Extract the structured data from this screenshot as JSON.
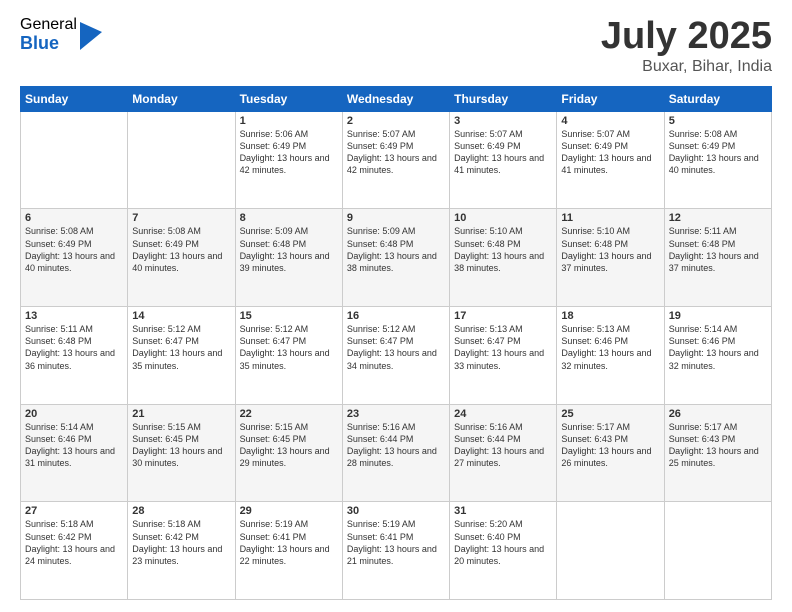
{
  "logo": {
    "general": "General",
    "blue": "Blue"
  },
  "header": {
    "month": "July 2025",
    "location": "Buxar, Bihar, India"
  },
  "weekdays": [
    "Sunday",
    "Monday",
    "Tuesday",
    "Wednesday",
    "Thursday",
    "Friday",
    "Saturday"
  ],
  "weeks": [
    [
      {
        "day": "",
        "sunrise": "",
        "sunset": "",
        "daylight": ""
      },
      {
        "day": "",
        "sunrise": "",
        "sunset": "",
        "daylight": ""
      },
      {
        "day": "1",
        "sunrise": "Sunrise: 5:06 AM",
        "sunset": "Sunset: 6:49 PM",
        "daylight": "Daylight: 13 hours and 42 minutes."
      },
      {
        "day": "2",
        "sunrise": "Sunrise: 5:07 AM",
        "sunset": "Sunset: 6:49 PM",
        "daylight": "Daylight: 13 hours and 42 minutes."
      },
      {
        "day": "3",
        "sunrise": "Sunrise: 5:07 AM",
        "sunset": "Sunset: 6:49 PM",
        "daylight": "Daylight: 13 hours and 41 minutes."
      },
      {
        "day": "4",
        "sunrise": "Sunrise: 5:07 AM",
        "sunset": "Sunset: 6:49 PM",
        "daylight": "Daylight: 13 hours and 41 minutes."
      },
      {
        "day": "5",
        "sunrise": "Sunrise: 5:08 AM",
        "sunset": "Sunset: 6:49 PM",
        "daylight": "Daylight: 13 hours and 40 minutes."
      }
    ],
    [
      {
        "day": "6",
        "sunrise": "Sunrise: 5:08 AM",
        "sunset": "Sunset: 6:49 PM",
        "daylight": "Daylight: 13 hours and 40 minutes."
      },
      {
        "day": "7",
        "sunrise": "Sunrise: 5:08 AM",
        "sunset": "Sunset: 6:49 PM",
        "daylight": "Daylight: 13 hours and 40 minutes."
      },
      {
        "day": "8",
        "sunrise": "Sunrise: 5:09 AM",
        "sunset": "Sunset: 6:48 PM",
        "daylight": "Daylight: 13 hours and 39 minutes."
      },
      {
        "day": "9",
        "sunrise": "Sunrise: 5:09 AM",
        "sunset": "Sunset: 6:48 PM",
        "daylight": "Daylight: 13 hours and 38 minutes."
      },
      {
        "day": "10",
        "sunrise": "Sunrise: 5:10 AM",
        "sunset": "Sunset: 6:48 PM",
        "daylight": "Daylight: 13 hours and 38 minutes."
      },
      {
        "day": "11",
        "sunrise": "Sunrise: 5:10 AM",
        "sunset": "Sunset: 6:48 PM",
        "daylight": "Daylight: 13 hours and 37 minutes."
      },
      {
        "day": "12",
        "sunrise": "Sunrise: 5:11 AM",
        "sunset": "Sunset: 6:48 PM",
        "daylight": "Daylight: 13 hours and 37 minutes."
      }
    ],
    [
      {
        "day": "13",
        "sunrise": "Sunrise: 5:11 AM",
        "sunset": "Sunset: 6:48 PM",
        "daylight": "Daylight: 13 hours and 36 minutes."
      },
      {
        "day": "14",
        "sunrise": "Sunrise: 5:12 AM",
        "sunset": "Sunset: 6:47 PM",
        "daylight": "Daylight: 13 hours and 35 minutes."
      },
      {
        "day": "15",
        "sunrise": "Sunrise: 5:12 AM",
        "sunset": "Sunset: 6:47 PM",
        "daylight": "Daylight: 13 hours and 35 minutes."
      },
      {
        "day": "16",
        "sunrise": "Sunrise: 5:12 AM",
        "sunset": "Sunset: 6:47 PM",
        "daylight": "Daylight: 13 hours and 34 minutes."
      },
      {
        "day": "17",
        "sunrise": "Sunrise: 5:13 AM",
        "sunset": "Sunset: 6:47 PM",
        "daylight": "Daylight: 13 hours and 33 minutes."
      },
      {
        "day": "18",
        "sunrise": "Sunrise: 5:13 AM",
        "sunset": "Sunset: 6:46 PM",
        "daylight": "Daylight: 13 hours and 32 minutes."
      },
      {
        "day": "19",
        "sunrise": "Sunrise: 5:14 AM",
        "sunset": "Sunset: 6:46 PM",
        "daylight": "Daylight: 13 hours and 32 minutes."
      }
    ],
    [
      {
        "day": "20",
        "sunrise": "Sunrise: 5:14 AM",
        "sunset": "Sunset: 6:46 PM",
        "daylight": "Daylight: 13 hours and 31 minutes."
      },
      {
        "day": "21",
        "sunrise": "Sunrise: 5:15 AM",
        "sunset": "Sunset: 6:45 PM",
        "daylight": "Daylight: 13 hours and 30 minutes."
      },
      {
        "day": "22",
        "sunrise": "Sunrise: 5:15 AM",
        "sunset": "Sunset: 6:45 PM",
        "daylight": "Daylight: 13 hours and 29 minutes."
      },
      {
        "day": "23",
        "sunrise": "Sunrise: 5:16 AM",
        "sunset": "Sunset: 6:44 PM",
        "daylight": "Daylight: 13 hours and 28 minutes."
      },
      {
        "day": "24",
        "sunrise": "Sunrise: 5:16 AM",
        "sunset": "Sunset: 6:44 PM",
        "daylight": "Daylight: 13 hours and 27 minutes."
      },
      {
        "day": "25",
        "sunrise": "Sunrise: 5:17 AM",
        "sunset": "Sunset: 6:43 PM",
        "daylight": "Daylight: 13 hours and 26 minutes."
      },
      {
        "day": "26",
        "sunrise": "Sunrise: 5:17 AM",
        "sunset": "Sunset: 6:43 PM",
        "daylight": "Daylight: 13 hours and 25 minutes."
      }
    ],
    [
      {
        "day": "27",
        "sunrise": "Sunrise: 5:18 AM",
        "sunset": "Sunset: 6:42 PM",
        "daylight": "Daylight: 13 hours and 24 minutes."
      },
      {
        "day": "28",
        "sunrise": "Sunrise: 5:18 AM",
        "sunset": "Sunset: 6:42 PM",
        "daylight": "Daylight: 13 hours and 23 minutes."
      },
      {
        "day": "29",
        "sunrise": "Sunrise: 5:19 AM",
        "sunset": "Sunset: 6:41 PM",
        "daylight": "Daylight: 13 hours and 22 minutes."
      },
      {
        "day": "30",
        "sunrise": "Sunrise: 5:19 AM",
        "sunset": "Sunset: 6:41 PM",
        "daylight": "Daylight: 13 hours and 21 minutes."
      },
      {
        "day": "31",
        "sunrise": "Sunrise: 5:20 AM",
        "sunset": "Sunset: 6:40 PM",
        "daylight": "Daylight: 13 hours and 20 minutes."
      },
      {
        "day": "",
        "sunrise": "",
        "sunset": "",
        "daylight": ""
      },
      {
        "day": "",
        "sunrise": "",
        "sunset": "",
        "daylight": ""
      }
    ]
  ]
}
